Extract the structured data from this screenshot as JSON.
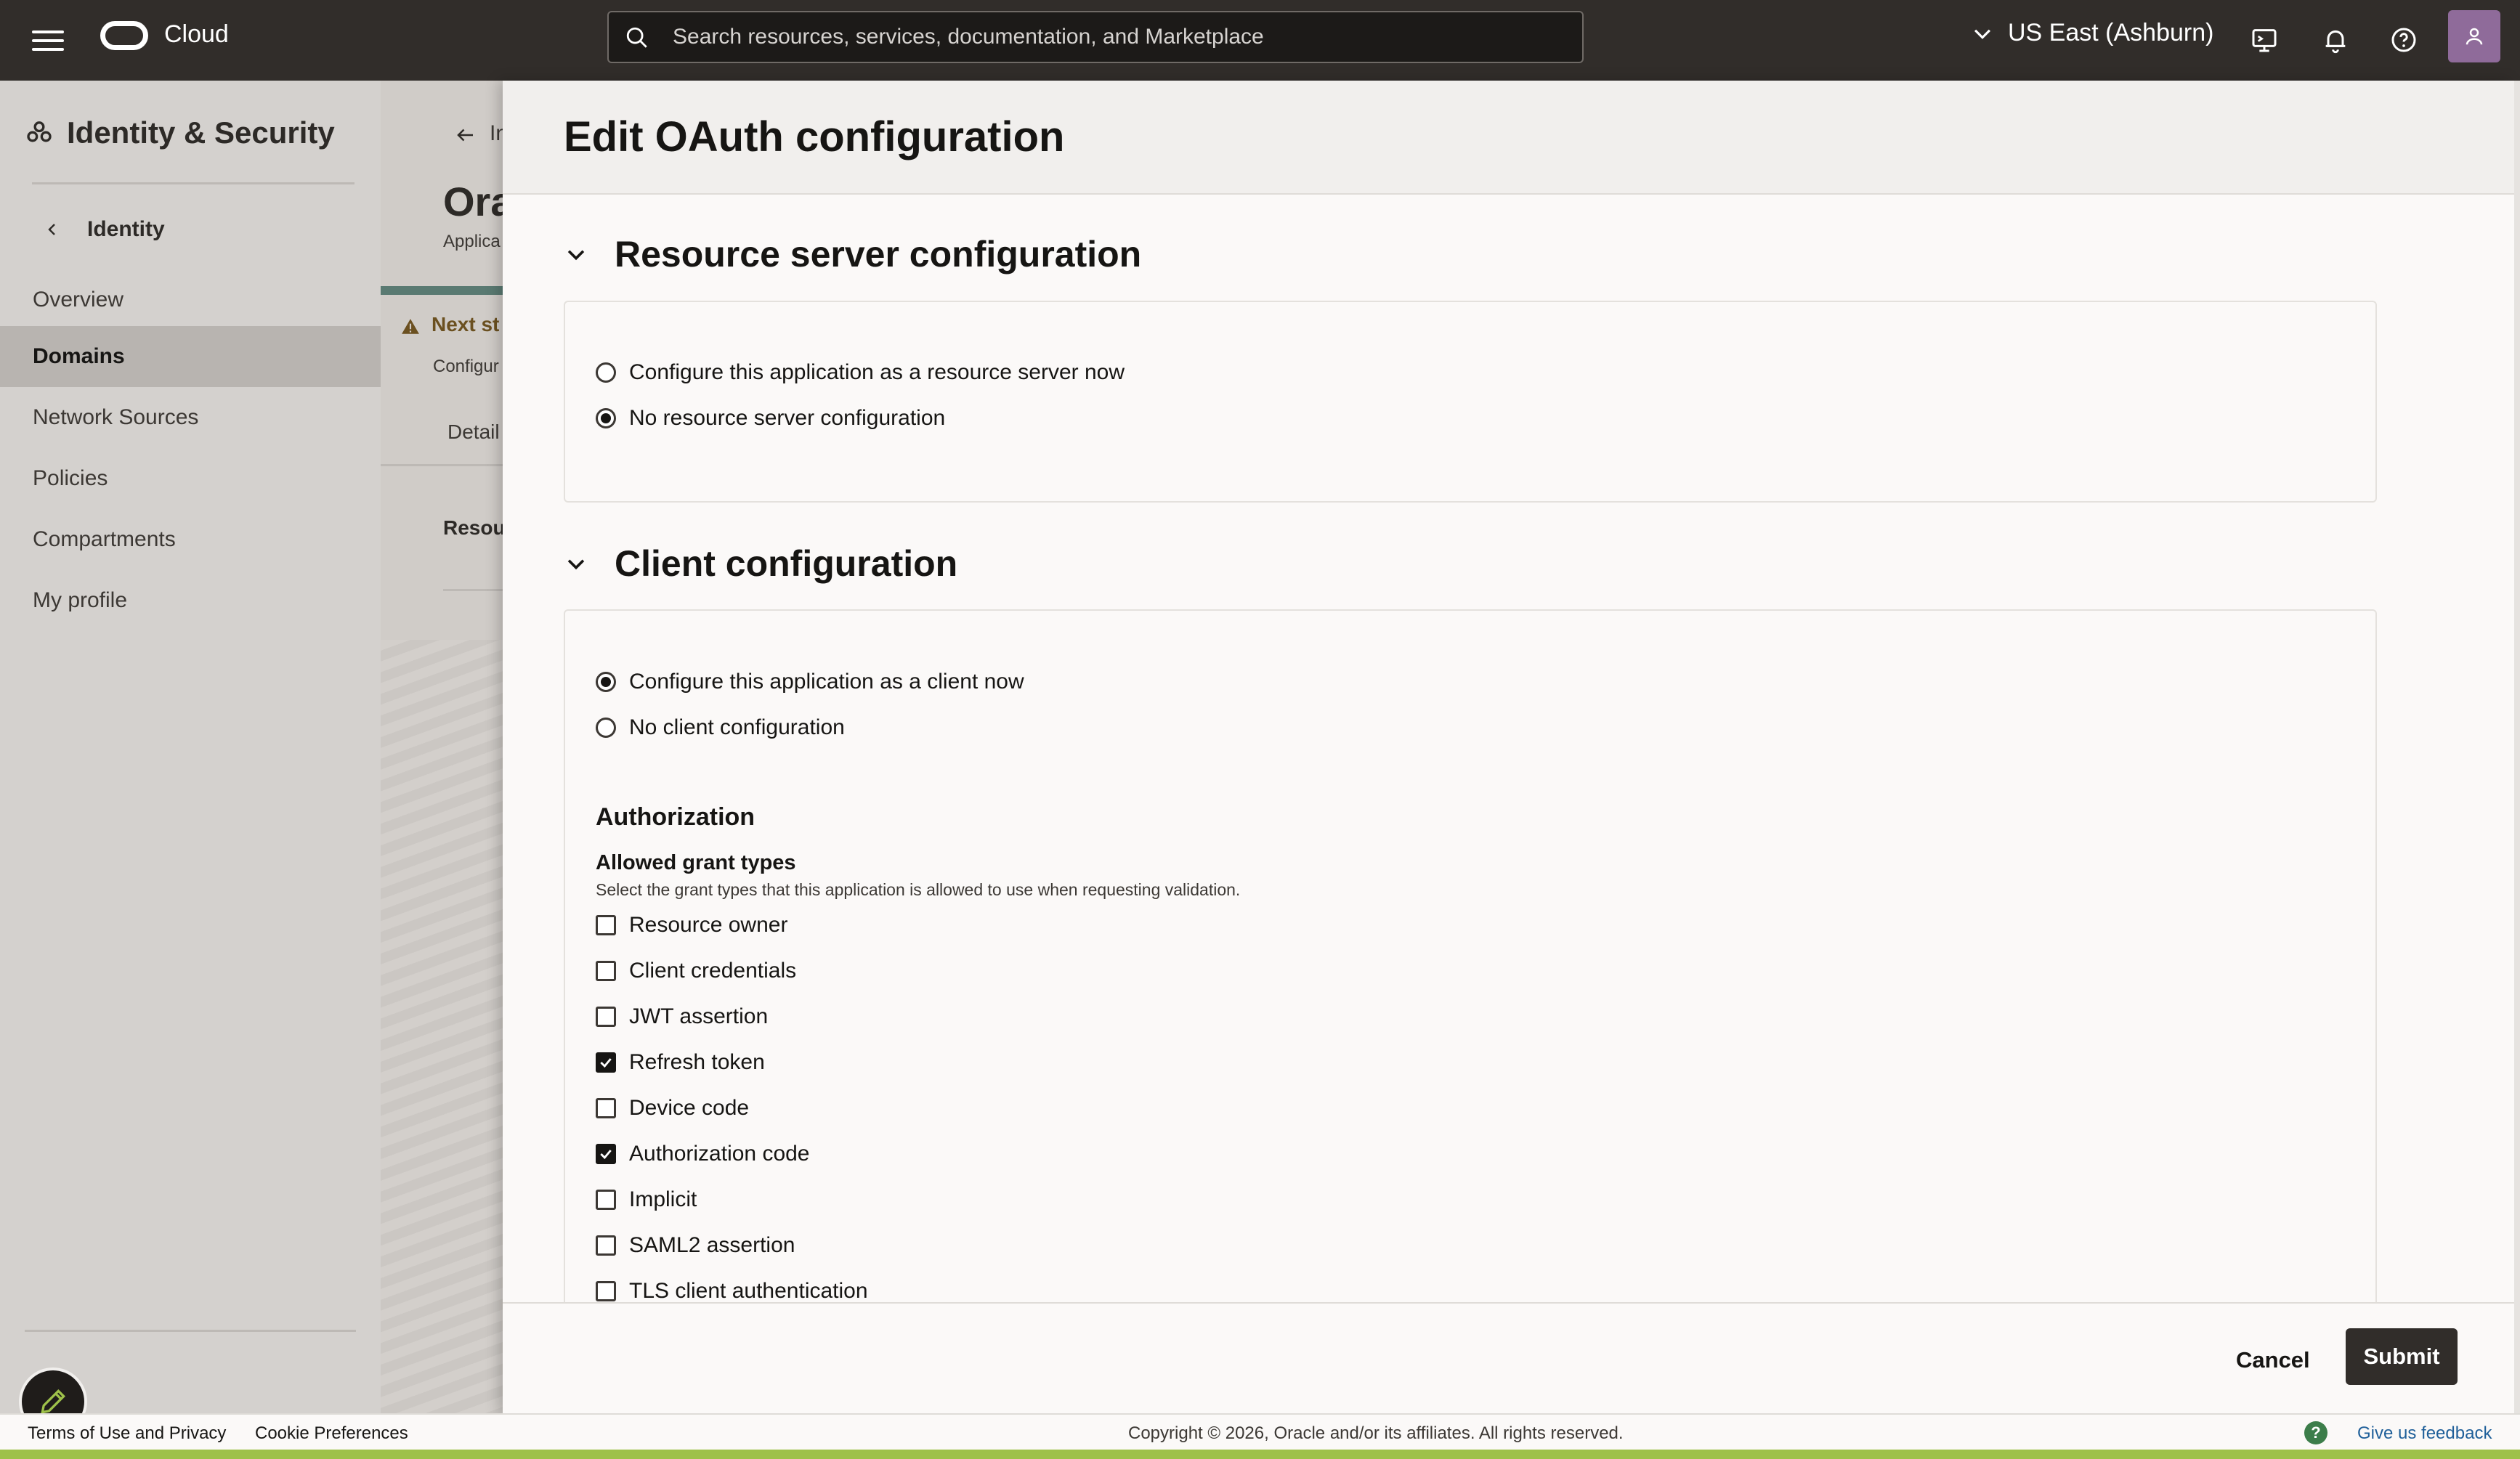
{
  "topbar": {
    "brand": "Cloud",
    "search_placeholder": "Search resources, services, documentation, and Marketplace",
    "region": "US East (Ashburn)"
  },
  "leftnav": {
    "title": "Identity & Security",
    "back_label": "Identity",
    "items": [
      {
        "label": "Overview",
        "active": false
      },
      {
        "label": "Domains",
        "active": true
      },
      {
        "label": "Network Sources",
        "active": false
      },
      {
        "label": "Policies",
        "active": false
      },
      {
        "label": "Compartments",
        "active": false
      },
      {
        "label": "My profile",
        "active": false
      }
    ]
  },
  "midpage": {
    "back_text": "In",
    "title": "Ora",
    "subtitle": "Applica",
    "next_step": "Next st",
    "configure": "Configur",
    "details_tab": "Detail",
    "resources": "Resou"
  },
  "drawer": {
    "title": "Edit OAuth configuration",
    "resource_section": {
      "heading": "Resource server configuration",
      "options": [
        {
          "label": "Configure this application as a resource server now",
          "selected": false
        },
        {
          "label": "No resource server configuration",
          "selected": true
        }
      ]
    },
    "client_section": {
      "heading": "Client configuration",
      "options": [
        {
          "label": "Configure this application as a client now",
          "selected": true
        },
        {
          "label": "No client configuration",
          "selected": false
        }
      ],
      "authorization_heading": "Authorization",
      "grant_types_heading": "Allowed grant types",
      "grant_types_help": "Select the grant types that this application is allowed to use when requesting validation.",
      "grant_types": [
        {
          "label": "Resource owner",
          "checked": false
        },
        {
          "label": "Client credentials",
          "checked": false
        },
        {
          "label": "JWT assertion",
          "checked": false
        },
        {
          "label": "Refresh token",
          "checked": true
        },
        {
          "label": "Device code",
          "checked": false
        },
        {
          "label": "Authorization code",
          "checked": true
        },
        {
          "label": "Implicit",
          "checked": false
        },
        {
          "label": "SAML2 assertion",
          "checked": false
        },
        {
          "label": "TLS client authentication",
          "checked": false
        }
      ]
    },
    "cancel_label": "Cancel",
    "submit_label": "Submit"
  },
  "footer": {
    "terms": "Terms of Use and Privacy",
    "cookie": "Cookie Preferences",
    "copyright": "Copyright © 2026, Oracle and/or its affiliates. All rights reserved.",
    "help_glyph": "?",
    "feedback": "Give us feedback"
  },
  "colors": {
    "topbar": "#312d2a",
    "accent_green": "#9ec14a",
    "link": "#1f5f99"
  }
}
